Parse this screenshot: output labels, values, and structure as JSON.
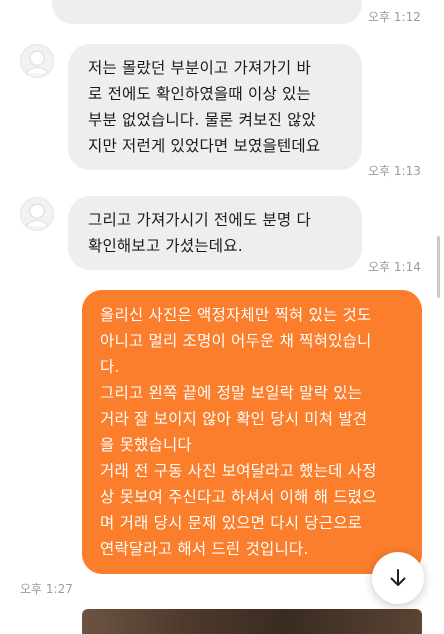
{
  "messages": [
    {
      "time": "오후 1:12"
    },
    {
      "lines": [
        "저는 몰랐던 부분이고 가져가기 바",
        "로 전에도 확인하였을때 이상 있는",
        "부분 없었습니다. 물론 켜보진 않았",
        "지만 저런게 있었다면 보였을텐데요"
      ],
      "time": "오후 1:13"
    },
    {
      "lines": [
        "그리고 가져가시기 전에도 분명 다",
        "확인해보고 가셨는데요."
      ],
      "time": "오후 1:14"
    },
    {
      "lines": [
        "올리신 사진은 액정자체만 찍혀 있는 것도",
        "아니고 멀리 조명이 어두운 채 찍혀있습니",
        "다.",
        "그리고 왼쪽 끝에 정말 보일락 말락 있는",
        "거라 잘 보이지 않아 확인 당시 미쳐 발견",
        "을 못했습니다",
        "거래 전 구동 사진 보여달라고 했는데 사정",
        "상 못보여 주신다고 하셔서 이해 해 드렸으",
        "며 거래 당시 문제 있으면 다시 당근으로",
        "연락달라고 해서 드린  것입니다."
      ],
      "time": "오후 1:27"
    }
  ],
  "icons": {
    "avatar": "default-profile-icon",
    "scroll_button": "arrow-down-icon"
  },
  "colors": {
    "incoming_bubble": "#eeeef0",
    "outgoing_bubble": "#fb7e2c",
    "timestamp": "#9b9b9b"
  }
}
